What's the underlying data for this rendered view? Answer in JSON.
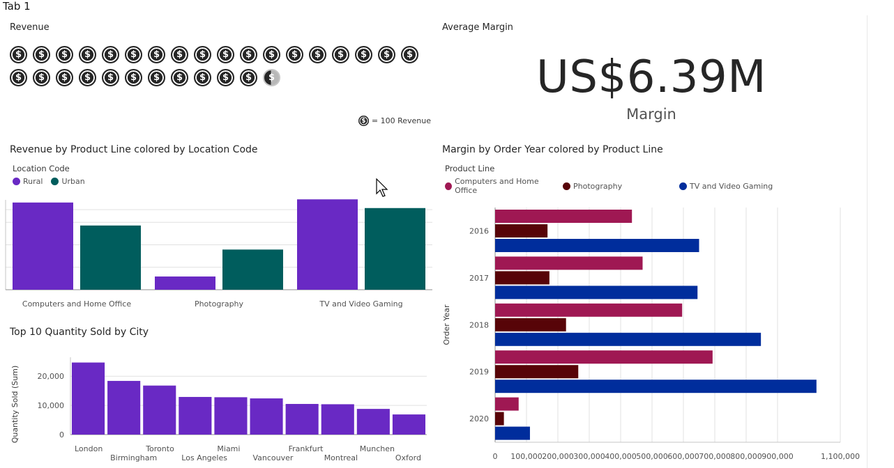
{
  "tab": {
    "label": "Tab 1"
  },
  "revenue_panel": {
    "title": "Revenue",
    "icon_name": "dollar-coin-icon",
    "icon_glyph": "$",
    "full_icons": 29,
    "partial_fraction": 0.45,
    "icons_per_row": 18,
    "legend_text": "= 100 Revenue"
  },
  "margin_panel": {
    "title": "Average Margin",
    "value": "US$6.39M",
    "label": "Margin"
  },
  "colors": {
    "purple": "#6929c4",
    "teal": "#005d5d",
    "magenta": "#9f1853",
    "maroon": "#570408",
    "blue": "#002d9c",
    "coin": "#262626",
    "grid": "#e0e0e0"
  },
  "chart_data": [
    {
      "id": "revenue_by_product_line",
      "type": "bar",
      "title": "Revenue by Product Line colored by Location Code",
      "legend_title": "Location Code",
      "legend_position": "top-left",
      "categories": [
        "Computers and Home Office",
        "Photography",
        "TV and Video Gaming"
      ],
      "series": [
        {
          "name": "Rural",
          "color": "#6929c4",
          "values": [
            3300,
            500,
            3420
          ]
        },
        {
          "name": "Urban",
          "color": "#005d5d",
          "values": [
            2430,
            1520,
            3090
          ]
        }
      ],
      "ylim": [
        0,
        3400
      ],
      "grid": true
    },
    {
      "id": "top10_quantity_by_city",
      "type": "bar",
      "title": "Top 10 Quantity Sold by City",
      "ylabel": "Quantity Sold (Sum)",
      "categories": [
        "London",
        "Birmingham",
        "Toronto",
        "Los Angeles",
        "Miami",
        "Vancouver",
        "Frankfurt",
        "Montreal",
        "Munchen",
        "Oxford"
      ],
      "values": [
        24700,
        18400,
        16800,
        12900,
        12800,
        12400,
        10500,
        10400,
        8800,
        6900
      ],
      "yticks": [
        "0",
        "10,000",
        "20,000"
      ],
      "ytick_values": [
        0,
        10000,
        20000
      ],
      "ylim": [
        0,
        26500
      ],
      "color": "#6929c4",
      "grid": true
    },
    {
      "id": "margin_by_order_year",
      "type": "bar",
      "orientation": "horizontal",
      "title": "Margin by Order Year colored by Product Line",
      "legend_title": "Product Line",
      "legend_position": "top-left",
      "ylabel": "Order Year",
      "categories": [
        "2016",
        "2017",
        "2018",
        "2019",
        "2020"
      ],
      "series": [
        {
          "name": "Computers and Home Office",
          "color": "#9f1853",
          "values": [
            436000,
            470000,
            596000,
            693000,
            75000
          ]
        },
        {
          "name": "Photography",
          "color": "#570408",
          "values": [
            167000,
            173000,
            226000,
            265000,
            28000
          ]
        },
        {
          "name": "TV and Video Gaming",
          "color": "#002d9c",
          "values": [
            650000,
            645000,
            847000,
            1024000,
            111000
          ]
        }
      ],
      "xticks": [
        "0",
        "100,000",
        "200,000",
        "300,000",
        "400,000",
        "500,000",
        "600,000",
        "700,000",
        "800,000",
        "900,000",
        "1,100,000"
      ],
      "xtick_values": [
        0,
        100000,
        200000,
        300000,
        400000,
        500000,
        600000,
        700000,
        800000,
        900000,
        1100000
      ],
      "xlim": [
        0,
        1100000
      ],
      "grid": true
    }
  ]
}
